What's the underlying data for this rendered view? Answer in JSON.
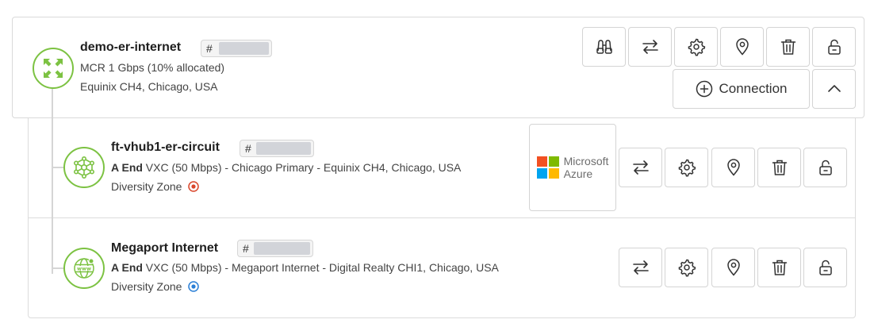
{
  "mcr": {
    "name": "demo-er-internet",
    "tag_prefix": "#",
    "speed": "MCR 1 Gbps (10% allocated)",
    "location": "Equinix CH4, Chicago, USA",
    "connection_label": "Connection",
    "icon": "expand-arrows-icon"
  },
  "connections": [
    {
      "name": "ft-vhub1-er-circuit",
      "tag_prefix": "#",
      "end_label": "A End",
      "detail": " VXC (50 Mbps) - Chicago Primary - Equinix CH4, Chicago, USA",
      "diversity_label": "Diversity Zone",
      "diversity_color": "#d9462b",
      "icon": "network-nodes-icon",
      "provider_logo_text_1": "Microsoft",
      "provider_logo_text_2": "Azure"
    },
    {
      "name": "Megaport Internet",
      "tag_prefix": "#",
      "end_label": "A End",
      "detail": " VXC (50 Mbps) - Megaport Internet - Digital Realty CHI1, Chicago, USA",
      "diversity_label": "Diversity Zone",
      "diversity_color": "#2a7fd6",
      "icon": "globe-www-icon"
    }
  ],
  "colors": {
    "accent_green": "#7cc242",
    "ms_red": "#f25022",
    "ms_green": "#7fba00",
    "ms_blue": "#00a4ef",
    "ms_yellow": "#ffb900"
  }
}
